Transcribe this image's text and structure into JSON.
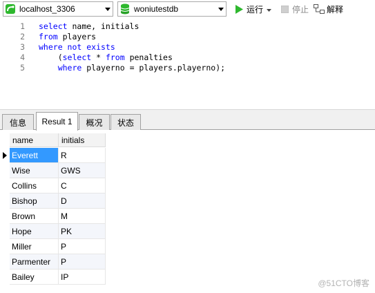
{
  "toolbar": {
    "connection": "localhost_3306",
    "database": "woniutestdb",
    "run_label": "运行",
    "stop_label": "停止",
    "explain_label": "解释"
  },
  "editor": {
    "lines": [
      {
        "num": "1",
        "tokens": [
          {
            "t": "select",
            "k": true
          },
          {
            "t": " name, initials",
            "k": false
          }
        ]
      },
      {
        "num": "2",
        "tokens": [
          {
            "t": "from",
            "k": true
          },
          {
            "t": " players",
            "k": false
          }
        ]
      },
      {
        "num": "3",
        "tokens": [
          {
            "t": "where not exists",
            "k": true
          }
        ]
      },
      {
        "num": "4",
        "tokens": [
          {
            "t": "    (",
            "k": false
          },
          {
            "t": "select",
            "k": true
          },
          {
            "t": " * ",
            "k": false
          },
          {
            "t": "from",
            "k": true
          },
          {
            "t": " penalties",
            "k": false
          }
        ]
      },
      {
        "num": "5",
        "tokens": [
          {
            "t": "    ",
            "k": false
          },
          {
            "t": "where",
            "k": true
          },
          {
            "t": " playerno = players.playerno);",
            "k": false
          }
        ]
      }
    ]
  },
  "tabs": [
    {
      "label": "信息",
      "active": false
    },
    {
      "label": "Result 1",
      "active": true
    },
    {
      "label": "概况",
      "active": false
    },
    {
      "label": "状态",
      "active": false
    }
  ],
  "grid": {
    "columns": [
      "name",
      "initials"
    ],
    "rows": [
      [
        "Everett",
        "R"
      ],
      [
        "Wise",
        "GWS"
      ],
      [
        "Collins",
        "C"
      ],
      [
        "Bishop",
        "D"
      ],
      [
        "Brown",
        "M"
      ],
      [
        "Hope",
        "PK"
      ],
      [
        "Miller",
        "P"
      ],
      [
        "Parmenter",
        "P"
      ],
      [
        "Bailey",
        "IP"
      ]
    ]
  },
  "watermark": "@51CTO博客",
  "colors": {
    "keyword": "#0000ff",
    "selection": "#3399ff",
    "run_icon": "#2eb82e",
    "db_icon": "#2eb82e"
  }
}
